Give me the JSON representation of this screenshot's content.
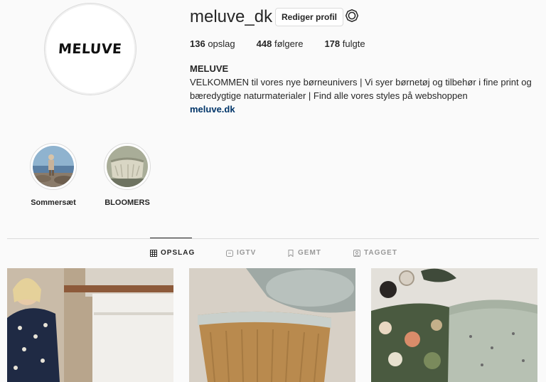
{
  "profile": {
    "avatar_text": "MELUVE",
    "username": "meluve_dk",
    "edit_profile_label": "Rediger profil",
    "settings_icon": "gear-icon"
  },
  "stats": [
    {
      "count": "136",
      "label": "opslag"
    },
    {
      "count": "448",
      "label": "følgere"
    },
    {
      "count": "178",
      "label": "fulgte"
    }
  ],
  "bio": {
    "name": "MELUVE",
    "text": "VELKOMMEN til vores nye børneunivers | Vi syer børnetøj og tilbehør i fine print og bæredygtige naturmaterialer | Find alle vores styles på webshoppen",
    "link": "meluve.dk"
  },
  "highlights": [
    {
      "label": "Sommersæt"
    },
    {
      "label": "BLOOMERS"
    }
  ],
  "tabs": [
    {
      "label": "OPSLAG",
      "icon": "grid-icon",
      "active": true
    },
    {
      "label": "IGTV",
      "icon": "tv-icon",
      "active": false
    },
    {
      "label": "GEMT",
      "icon": "bookmark-icon",
      "active": false
    },
    {
      "label": "TAGGET",
      "icon": "tag-person-icon",
      "active": false
    }
  ],
  "colors": {
    "background": "#fafafa",
    "text": "#262626",
    "link": "#003569",
    "border": "#dbdbdb",
    "inactive_tab": "#999999"
  }
}
